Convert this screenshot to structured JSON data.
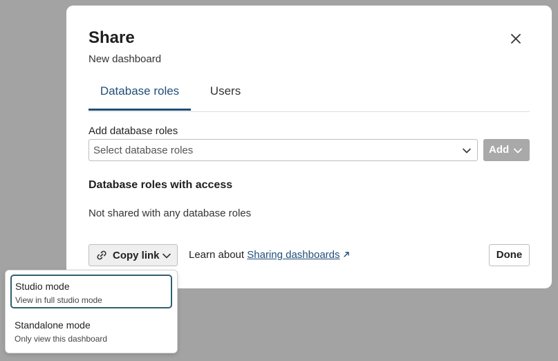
{
  "modal": {
    "title": "Share",
    "subtitle": "New dashboard",
    "tabs": [
      {
        "label": "Database roles",
        "active": true
      },
      {
        "label": "Users",
        "active": false
      }
    ],
    "add_roles": {
      "label": "Add database roles",
      "placeholder": "Select database roles",
      "add_button": "Add"
    },
    "access_section": {
      "heading": "Database roles with access",
      "empty_text": "Not shared with any database roles"
    },
    "footer": {
      "copy_link_label": "Copy link",
      "learn_prefix": "Learn about",
      "learn_link": "Sharing dashboards",
      "done_label": "Done"
    }
  },
  "copy_menu": {
    "items": [
      {
        "title": "Studio mode",
        "description": "View in full studio mode",
        "selected": true
      },
      {
        "title": "Standalone mode",
        "description": "Only view this dashboard",
        "selected": false
      }
    ]
  },
  "colors": {
    "accent": "#1f4e79",
    "backdrop": "#a3a3a3",
    "disabled_button": "#a9a9a9",
    "selected_outline": "#2f5f6f"
  }
}
